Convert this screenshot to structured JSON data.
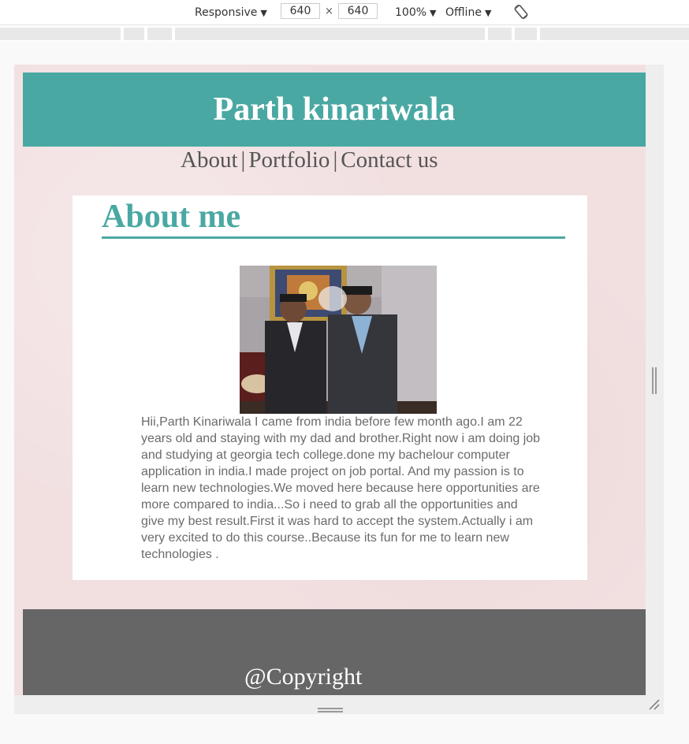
{
  "devtools": {
    "device_mode": "Responsive",
    "width": "640",
    "height": "640",
    "times": "×",
    "zoom": "100%",
    "throttle": "Offline",
    "rotate_icon": "rotate-icon"
  },
  "site": {
    "title": "Parth kinariwala",
    "nav": {
      "about": "About",
      "portfolio": "Portfolio",
      "contact": "Contact us",
      "separator": "|"
    },
    "about": {
      "heading": "About me",
      "photo_alt": "photo",
      "text": "Hii,Parth Kinariwala I came from india before few month ago.I am 22 years old and staying with my dad and brother.Right now i am doing job and studying at georgia tech college.done my bachelour computer application in india.I made project on job portal. And my passion is to learn new technologies.We moved here because here opportunities are more compared to india...So i need to grab all the opportunities and give my best result.First it was hard to accept the system.Actually i am very excited to do this course..Because its fun for me to learn new technologies ."
    },
    "footer": {
      "copyright": "@Copyright"
    }
  },
  "colors": {
    "header_bg": "#4aa8a3",
    "page_bg": "#f2e0e1",
    "footer_bg": "#666666",
    "heading": "#4aa8a3"
  }
}
